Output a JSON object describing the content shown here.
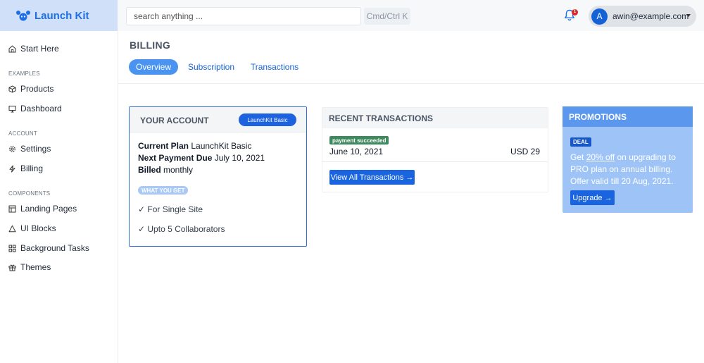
{
  "brand": {
    "name": "Launch Kit"
  },
  "search": {
    "placeholder": "search anything ...",
    "shortcut": "Cmd/Ctrl K"
  },
  "notifications": {
    "count": "1"
  },
  "user": {
    "initial": "A",
    "email": "awin@example.com"
  },
  "sidebar": {
    "start": "Start Here",
    "sections": {
      "examples": "EXAMPLES",
      "account": "ACCOUNT",
      "components": "COMPONENTS"
    },
    "examples": [
      "Products",
      "Dashboard"
    ],
    "account": [
      "Settings",
      "Billing"
    ],
    "components": [
      "Landing Pages",
      "UI Blocks",
      "Background Tasks",
      "Themes"
    ]
  },
  "page": {
    "title": "BILLING",
    "tabs": [
      "Overview",
      "Subscription",
      "Transactions"
    ],
    "active_tab": "Overview"
  },
  "account": {
    "title": "YOUR ACCOUNT",
    "plan_badge": "LaunchKit Basic",
    "current_plan_label": "Current Plan",
    "current_plan_value": "LaunchKit Basic",
    "next_payment_label": "Next Payment Due",
    "next_payment_value": "July 10, 2021",
    "billed_label": "Billed",
    "billed_value": "monthly",
    "features_label": "WHAT YOU GET",
    "features": [
      "✓ For Single Site",
      "✓ Upto 5 Collaborators"
    ]
  },
  "transactions": {
    "title": "RECENT TRANSACTIONS",
    "items": [
      {
        "status": "payment succeeded",
        "date": "June 10, 2021",
        "amount": "USD 29"
      }
    ],
    "view_all": "View All Transactions →"
  },
  "promotions": {
    "title": "PROMOTIONS",
    "badge": "DEAL",
    "text_before": "Get ",
    "highlight": "20% off",
    "text_after": " on upgrading to PRO plan on annual billing. Offer valid till 20 Aug, 2021.",
    "button": "Upgrade →"
  },
  "colors": {
    "accent": "#1a64e0",
    "brand_bg": "#cfe0f8",
    "promo_bg": "#9ec4f7",
    "success": "#3e8a5e"
  },
  "icons": {
    "brand": "paw-logo-icon",
    "bell": "bell-icon",
    "start": "home-icon",
    "products": "cube-icon",
    "dashboard": "monitor-icon",
    "settings": "gear-icon",
    "billing": "lightning-icon",
    "landing_pages": "layout-icon",
    "ui_blocks": "triangle-icon",
    "background_tasks": "grid-icon",
    "themes": "gift-icon"
  }
}
